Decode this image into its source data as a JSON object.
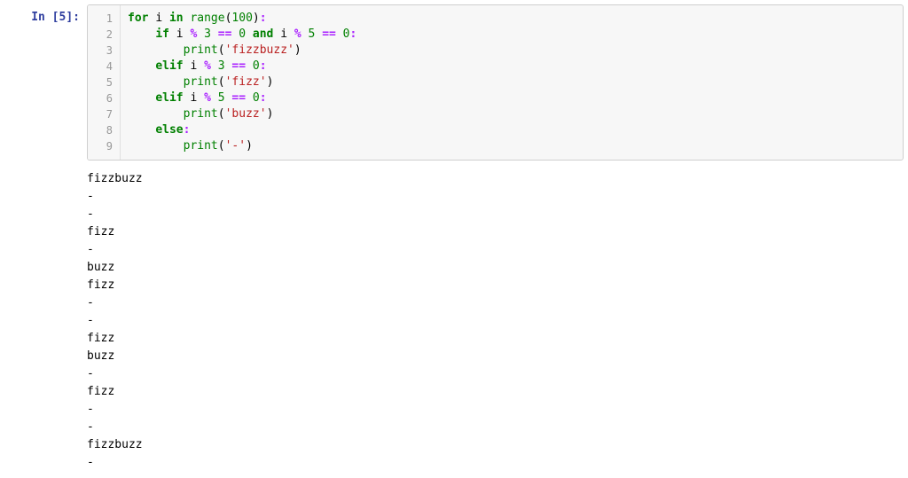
{
  "prompt": {
    "label": "In",
    "number": "5"
  },
  "code": {
    "gutter": [
      "1",
      "2",
      "3",
      "4",
      "5",
      "6",
      "7",
      "8",
      "9"
    ],
    "tokens": [
      [
        [
          "kw",
          "for"
        ],
        [
          "sp",
          " "
        ],
        [
          "var",
          "i"
        ],
        [
          "sp",
          " "
        ],
        [
          "kw",
          "in"
        ],
        [
          "sp",
          " "
        ],
        [
          "builtin",
          "range"
        ],
        [
          "punc",
          "("
        ],
        [
          "num",
          "100"
        ],
        [
          "punc",
          ")"
        ],
        [
          "op",
          ":"
        ]
      ],
      [
        [
          "pad",
          "    "
        ],
        [
          "kw",
          "if"
        ],
        [
          "sp",
          " "
        ],
        [
          "var",
          "i"
        ],
        [
          "sp",
          " "
        ],
        [
          "op",
          "%"
        ],
        [
          "sp",
          " "
        ],
        [
          "num",
          "3"
        ],
        [
          "sp",
          " "
        ],
        [
          "op",
          "=="
        ],
        [
          "sp",
          " "
        ],
        [
          "num",
          "0"
        ],
        [
          "sp",
          " "
        ],
        [
          "kw",
          "and"
        ],
        [
          "sp",
          " "
        ],
        [
          "var",
          "i"
        ],
        [
          "sp",
          " "
        ],
        [
          "op",
          "%"
        ],
        [
          "sp",
          " "
        ],
        [
          "num",
          "5"
        ],
        [
          "sp",
          " "
        ],
        [
          "op",
          "=="
        ],
        [
          "sp",
          " "
        ],
        [
          "num",
          "0"
        ],
        [
          "op",
          ":"
        ]
      ],
      [
        [
          "pad",
          "        "
        ],
        [
          "builtin",
          "print"
        ],
        [
          "punc",
          "("
        ],
        [
          "str",
          "'fizzbuzz'"
        ],
        [
          "punc",
          ")"
        ]
      ],
      [
        [
          "pad",
          "    "
        ],
        [
          "kw",
          "elif"
        ],
        [
          "sp",
          " "
        ],
        [
          "var",
          "i"
        ],
        [
          "sp",
          " "
        ],
        [
          "op",
          "%"
        ],
        [
          "sp",
          " "
        ],
        [
          "num",
          "3"
        ],
        [
          "sp",
          " "
        ],
        [
          "op",
          "=="
        ],
        [
          "sp",
          " "
        ],
        [
          "num",
          "0"
        ],
        [
          "op",
          ":"
        ]
      ],
      [
        [
          "pad",
          "        "
        ],
        [
          "builtin",
          "print"
        ],
        [
          "punc",
          "("
        ],
        [
          "str",
          "'fizz'"
        ],
        [
          "punc",
          ")"
        ]
      ],
      [
        [
          "pad",
          "    "
        ],
        [
          "kw",
          "elif"
        ],
        [
          "sp",
          " "
        ],
        [
          "var",
          "i"
        ],
        [
          "sp",
          " "
        ],
        [
          "op",
          "%"
        ],
        [
          "sp",
          " "
        ],
        [
          "num",
          "5"
        ],
        [
          "sp",
          " "
        ],
        [
          "op",
          "=="
        ],
        [
          "sp",
          " "
        ],
        [
          "num",
          "0"
        ],
        [
          "op",
          ":"
        ]
      ],
      [
        [
          "pad",
          "        "
        ],
        [
          "builtin",
          "print"
        ],
        [
          "punc",
          "("
        ],
        [
          "str",
          "'buzz'"
        ],
        [
          "punc",
          ")"
        ]
      ],
      [
        [
          "pad",
          "    "
        ],
        [
          "kw",
          "else"
        ],
        [
          "op",
          ":"
        ]
      ],
      [
        [
          "pad",
          "        "
        ],
        [
          "builtin",
          "print"
        ],
        [
          "punc",
          "("
        ],
        [
          "str",
          "'-'"
        ],
        [
          "punc",
          ")"
        ]
      ]
    ]
  },
  "output_lines": [
    "fizzbuzz",
    "-",
    "-",
    "fizz",
    "-",
    "buzz",
    "fizz",
    "-",
    "-",
    "fizz",
    "buzz",
    "-",
    "fizz",
    "-",
    "-",
    "fizzbuzz",
    "-"
  ]
}
